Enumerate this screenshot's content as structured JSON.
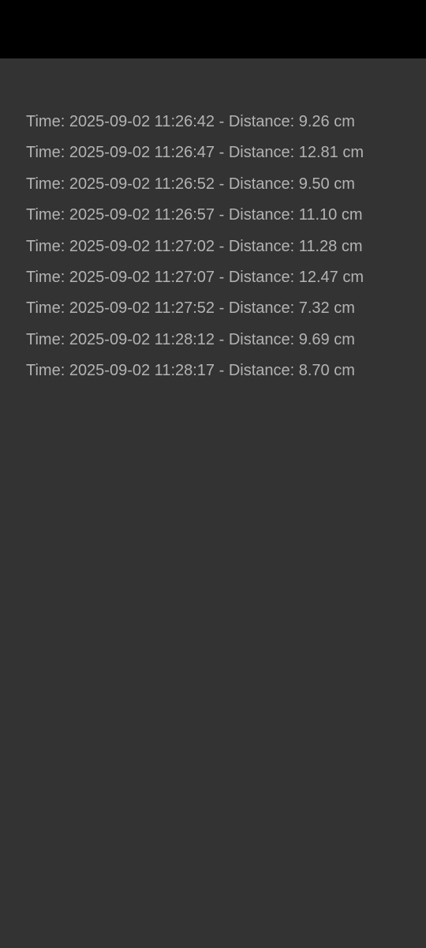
{
  "log": {
    "entries": [
      "Time: 2025-09-02 11:26:42 - Distance: 9.26 cm",
      "Time: 2025-09-02 11:26:47 - Distance: 12.81 cm",
      "Time: 2025-09-02 11:26:52 - Distance: 9.50 cm",
      "Time: 2025-09-02 11:26:57 - Distance: 11.10 cm",
      "Time: 2025-09-02 11:27:02 - Distance: 11.28 cm",
      "Time: 2025-09-02 11:27:07 - Distance: 12.47 cm",
      "Time: 2025-09-02 11:27:52 - Distance: 7.32 cm",
      "Time: 2025-09-02 11:28:12 - Distance: 9.69 cm",
      "Time: 2025-09-02 11:28:17 - Distance: 8.70 cm"
    ]
  },
  "colors": {
    "background": "#333333",
    "status_bar": "#000000",
    "text": "#b3b3b3"
  }
}
